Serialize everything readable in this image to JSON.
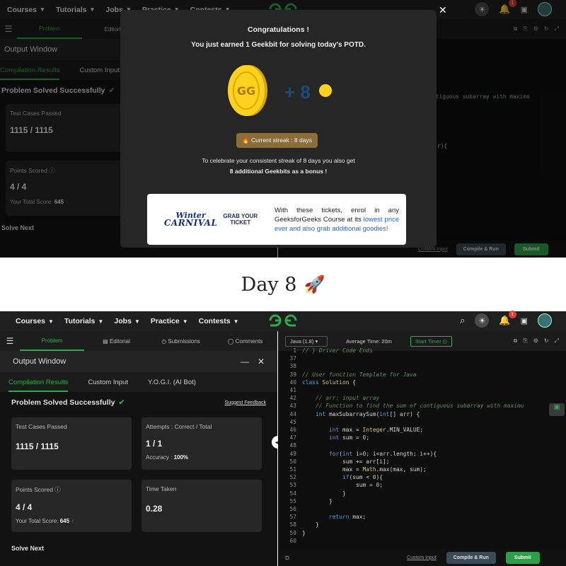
{
  "nav": {
    "items": [
      "Courses",
      "Tutorials",
      "Jobs",
      "Practice",
      "Contests"
    ],
    "notification_count": "1"
  },
  "top_panel": {
    "tabs": {
      "problem": "Problem",
      "editorial": "Editorial"
    },
    "output_window": "Output Window",
    "subtabs": {
      "compilation": "Compilation Results",
      "custom": "Custom Input"
    },
    "status": "Problem Solved Successfully",
    "test_cases_label": "Test Cases Passed",
    "test_cases_value": "1115 / 1115",
    "points_label": "Points Scored",
    "points_value": "4 / 4",
    "total_score_label": "Your Total Score:",
    "total_score_value": "645",
    "solve_next": "Solve Next",
    "code_peek_1": "ntiguous subarray with maximu",
    "code_peek_2": "r){",
    "custom_input": "Custom Input",
    "compile_run": "Compile & Run",
    "submit": "Submit"
  },
  "modal": {
    "title": "Congratulations !",
    "subtitle": "You just earned 1 Geekbit for solving today's POTD.",
    "bonus_plus": "+ 8",
    "streak": "Current streak : 8 days",
    "celebrate_line1": "To celebrate your consistent streak of 8 days you also get",
    "celebrate_line2": "8 additional Geekbits as a bonus !",
    "banner_title1": "Winter",
    "banner_title2": "CARNIVAL",
    "banner_cta1": "GRAB YOUR",
    "banner_cta2": "TICKET",
    "banner_text_a": "With these tickets, enrol in any GeeksforGeeks Course at its ",
    "banner_text_hl": "lowest price ever and also grab additional goodies!"
  },
  "caption": {
    "text": "Day 8",
    "emoji": "🚀"
  },
  "bottom_panel": {
    "tabs": {
      "problem": "Problem",
      "editorial": "Editorial",
      "submissions": "Submissions",
      "comments": "Comments"
    },
    "output_window": "Output Window",
    "subtabs": {
      "compilation": "Compilation Results",
      "custom": "Custom Input",
      "yogi": "Y.O.G.I. (AI Bot)"
    },
    "status": "Problem Solved Successfully",
    "suggest": "Suggest Feedback",
    "test_cases_label": "Test Cases Passed",
    "test_cases_value": "1115 / 1115",
    "attempts_label": "Attempts : Correct / Total",
    "attempts_value": "1 / 1",
    "accuracy_label": "Accuracy :",
    "accuracy_value": "100%",
    "points_label": "Points Scored",
    "points_value": "4 / 4",
    "total_score_label": "Your Total Score:",
    "total_score_value": "645",
    "time_label": "Time Taken",
    "time_value": "0.28",
    "solve_next": "Solve Next",
    "language": "Java (1.8)",
    "avg_time": "Average Time: 20m",
    "start_timer": "Start Timer",
    "custom_input": "Custom Input",
    "compile_run": "Compile & Run",
    "submit": "Submit",
    "line_numbers": [
      "1",
      "37",
      "38",
      "39",
      "40",
      "41",
      "42",
      "43",
      "44",
      "45",
      "46",
      "47",
      "48",
      "49",
      "50",
      "51",
      "52",
      "53",
      "54",
      "55",
      "56",
      "57",
      "58",
      "59",
      "60"
    ],
    "code_lines": [
      "// } Driver Code Ends",
      "",
      "",
      "// User function Template for Java",
      "class Solution {",
      "",
      "    // arr: input array",
      "    // Function to find the sum of contiguous subarray with maximu",
      "    int maxSubarraySum(int[] arr) {",
      "",
      "        int max = Integer.MIN_VALUE;",
      "        int sum = 0;",
      "",
      "        for(int i=0; i<arr.length; i++){",
      "            sum += arr[i];",
      "            max = Math.max(max, sum);",
      "            if(sum < 0){",
      "                sum = 0;",
      "            }",
      "        }",
      "",
      "        return max;",
      "    }",
      "}",
      ""
    ]
  }
}
